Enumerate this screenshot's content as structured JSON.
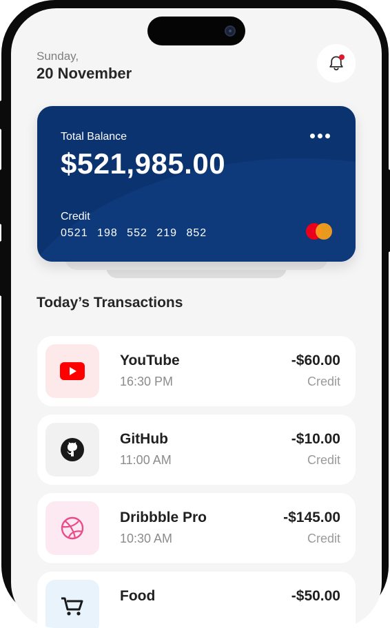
{
  "header": {
    "day": "Sunday,",
    "date": "20 November"
  },
  "card": {
    "label": "Total Balance",
    "balance": "$521,985.00",
    "type": "Credit",
    "number": "0521 198 552 219 852"
  },
  "section_title": "Today’s Transactions",
  "transactions": [
    {
      "name": "YouTube",
      "time": "16:30 PM",
      "amount": "-$60.00",
      "type": "Credit",
      "icon": "youtube-icon",
      "icon_bg": "#fde8ea",
      "icon_color": "#ff0000"
    },
    {
      "name": "GitHub",
      "time": "11:00 AM",
      "amount": "-$10.00",
      "type": "Credit",
      "icon": "github-icon",
      "icon_bg": "#f1f1f1",
      "icon_color": "#1a1a1a"
    },
    {
      "name": "Dribbble Pro",
      "time": "10:30 AM",
      "amount": "-$145.00",
      "type": "Credit",
      "icon": "dribbble-icon",
      "icon_bg": "#fde9f1",
      "icon_color": "#ea4c89"
    },
    {
      "name": "Food",
      "time": "",
      "amount": "-$50.00",
      "type": "",
      "icon": "cart-icon",
      "icon_bg": "#e8f3fb",
      "icon_color": "#1a1a1a"
    }
  ],
  "colors": {
    "card": "#0b3370",
    "notification_dot": "#e0192c",
    "background": "#f5f5f5"
  }
}
